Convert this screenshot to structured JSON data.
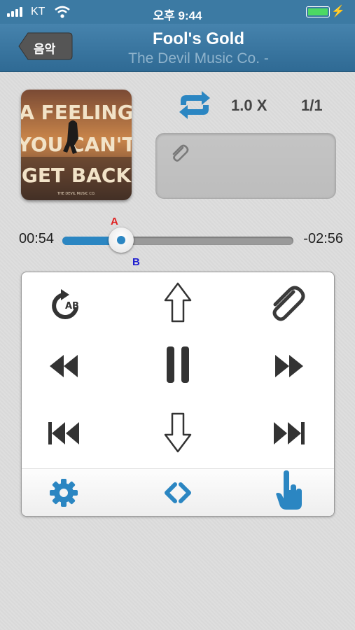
{
  "status_bar": {
    "carrier": "KT",
    "time": "오후 9:44"
  },
  "nav": {
    "back_label": "음악",
    "title": "Fool's Gold",
    "subtitle": "The Devil Music Co. -"
  },
  "album_art": {
    "line1": "A FEELING",
    "line2": "YOU CAN'T",
    "line3": "GET BACK",
    "footer": "THE DEVIL MUSIC CO."
  },
  "player": {
    "speed": "1.0 X",
    "count": "1/1",
    "current_time": "00:54",
    "remaining_time": "-02:56",
    "progress": 0.26,
    "marker_a": "A",
    "marker_b": "B"
  },
  "controls": {
    "ab_badge": "AB",
    "icons": [
      "ab-repeat-icon",
      "arrow-up-icon",
      "paperclip-icon",
      "rewind-icon",
      "pause-icon",
      "fast-forward-icon",
      "skip-previous-icon",
      "arrow-down-icon",
      "skip-next-icon",
      "gear-icon",
      "code-brackets-icon",
      "hand-pointer-icon"
    ]
  },
  "colors": {
    "nav_bar": "#3c7aa3",
    "accent_blue": "#2b86c2",
    "marker_a": "#e02020",
    "marker_b": "#1f1fcf",
    "battery": "#4cd964"
  }
}
